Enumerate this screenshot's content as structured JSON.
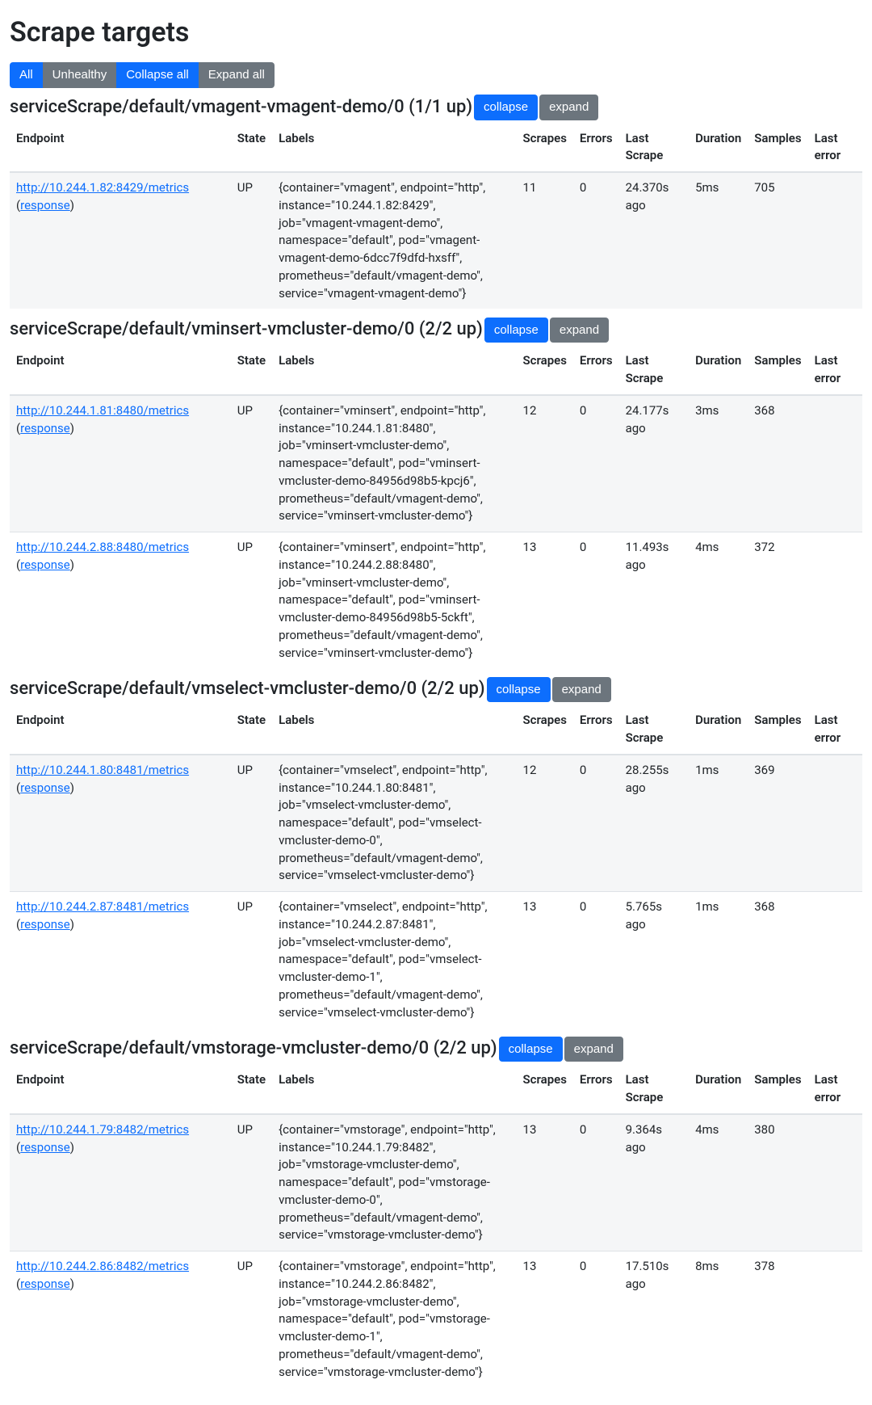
{
  "title": "Scrape targets",
  "filters": {
    "all": "All",
    "unhealthy": "Unhealthy",
    "collapse_all": "Collapse all",
    "expand_all": "Expand all"
  },
  "collapse_label": "collapse",
  "expand_label": "expand",
  "columns": {
    "endpoint": "Endpoint",
    "state": "State",
    "labels": "Labels",
    "scrapes": "Scrapes",
    "errors": "Errors",
    "last_scrape": "Last Scrape",
    "duration": "Duration",
    "samples": "Samples",
    "last_error": "Last error"
  },
  "response_label": "response",
  "groups": [
    {
      "title": "serviceScrape/default/vmagent-vmagent-demo/0 (1/1 up)",
      "targets": [
        {
          "endpoint": "http://10.244.1.82:8429/metrics",
          "state": "UP",
          "labels": "{container=\"vmagent\", endpoint=\"http\", instance=\"10.244.1.82:8429\", job=\"vmagent-vmagent-demo\", namespace=\"default\", pod=\"vmagent-vmagent-demo-6dcc7f9dfd-hxsff\", prometheus=\"default/vmagent-demo\", service=\"vmagent-vmagent-demo\"}",
          "scrapes": "11",
          "errors": "0",
          "last_scrape": "24.370s ago",
          "duration": "5ms",
          "samples": "705",
          "last_error": ""
        }
      ]
    },
    {
      "title": "serviceScrape/default/vminsert-vmcluster-demo/0 (2/2 up)",
      "targets": [
        {
          "endpoint": "http://10.244.1.81:8480/metrics",
          "state": "UP",
          "labels": "{container=\"vminsert\", endpoint=\"http\", instance=\"10.244.1.81:8480\", job=\"vminsert-vmcluster-demo\", namespace=\"default\", pod=\"vminsert-vmcluster-demo-84956d98b5-kpcj6\", prometheus=\"default/vmagent-demo\", service=\"vminsert-vmcluster-demo\"}",
          "scrapes": "12",
          "errors": "0",
          "last_scrape": "24.177s ago",
          "duration": "3ms",
          "samples": "368",
          "last_error": ""
        },
        {
          "endpoint": "http://10.244.2.88:8480/metrics",
          "state": "UP",
          "labels": "{container=\"vminsert\", endpoint=\"http\", instance=\"10.244.2.88:8480\", job=\"vminsert-vmcluster-demo\", namespace=\"default\", pod=\"vminsert-vmcluster-demo-84956d98b5-5ckft\", prometheus=\"default/vmagent-demo\", service=\"vminsert-vmcluster-demo\"}",
          "scrapes": "13",
          "errors": "0",
          "last_scrape": "11.493s ago",
          "duration": "4ms",
          "samples": "372",
          "last_error": ""
        }
      ]
    },
    {
      "title": "serviceScrape/default/vmselect-vmcluster-demo/0 (2/2 up)",
      "targets": [
        {
          "endpoint": "http://10.244.1.80:8481/metrics",
          "state": "UP",
          "labels": "{container=\"vmselect\", endpoint=\"http\", instance=\"10.244.1.80:8481\", job=\"vmselect-vmcluster-demo\", namespace=\"default\", pod=\"vmselect-vmcluster-demo-0\", prometheus=\"default/vmagent-demo\", service=\"vmselect-vmcluster-demo\"}",
          "scrapes": "12",
          "errors": "0",
          "last_scrape": "28.255s ago",
          "duration": "1ms",
          "samples": "369",
          "last_error": ""
        },
        {
          "endpoint": "http://10.244.2.87:8481/metrics",
          "state": "UP",
          "labels": "{container=\"vmselect\", endpoint=\"http\", instance=\"10.244.2.87:8481\", job=\"vmselect-vmcluster-demo\", namespace=\"default\", pod=\"vmselect-vmcluster-demo-1\", prometheus=\"default/vmagent-demo\", service=\"vmselect-vmcluster-demo\"}",
          "scrapes": "13",
          "errors": "0",
          "last_scrape": "5.765s ago",
          "duration": "1ms",
          "samples": "368",
          "last_error": ""
        }
      ]
    },
    {
      "title": "serviceScrape/default/vmstorage-vmcluster-demo/0 (2/2 up)",
      "targets": [
        {
          "endpoint": "http://10.244.1.79:8482/metrics",
          "state": "UP",
          "labels": "{container=\"vmstorage\", endpoint=\"http\", instance=\"10.244.1.79:8482\", job=\"vmstorage-vmcluster-demo\", namespace=\"default\", pod=\"vmstorage-vmcluster-demo-0\", prometheus=\"default/vmagent-demo\", service=\"vmstorage-vmcluster-demo\"}",
          "scrapes": "13",
          "errors": "0",
          "last_scrape": "9.364s ago",
          "duration": "4ms",
          "samples": "380",
          "last_error": ""
        },
        {
          "endpoint": "http://10.244.2.86:8482/metrics",
          "state": "UP",
          "labels": "{container=\"vmstorage\", endpoint=\"http\", instance=\"10.244.2.86:8482\", job=\"vmstorage-vmcluster-demo\", namespace=\"default\", pod=\"vmstorage-vmcluster-demo-1\", prometheus=\"default/vmagent-demo\", service=\"vmstorage-vmcluster-demo\"}",
          "scrapes": "13",
          "errors": "0",
          "last_scrape": "17.510s ago",
          "duration": "8ms",
          "samples": "378",
          "last_error": ""
        }
      ]
    }
  ]
}
